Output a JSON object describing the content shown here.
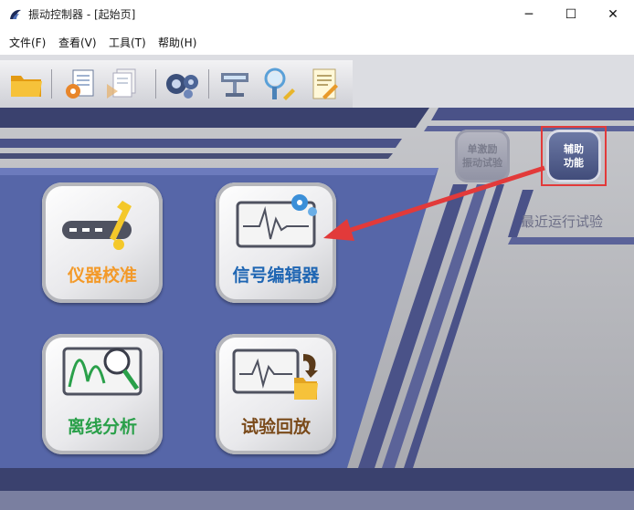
{
  "window": {
    "title": "振动控制器 - [起始页]",
    "controls": {
      "minimize": "─",
      "maximize": "☐",
      "close": "✕"
    }
  },
  "menu": {
    "items": [
      {
        "label": "文件(F)"
      },
      {
        "label": "查看(V)"
      },
      {
        "label": "工具(T)"
      },
      {
        "label": "帮助(H)"
      }
    ]
  },
  "toolbar": {
    "buttons": [
      {
        "icon": "open-folder-icon"
      },
      {
        "icon": "document-settings-icon"
      },
      {
        "icon": "document-run-icon"
      },
      {
        "icon": "gears-icon"
      },
      {
        "icon": "hardware-connect-icon"
      },
      {
        "icon": "search-edit-icon"
      },
      {
        "icon": "report-edit-icon"
      }
    ]
  },
  "main": {
    "buttons": {
      "calibration": {
        "label": "仪器校准",
        "color": "#f39a2a"
      },
      "signal_editor": {
        "label": "信号编辑器",
        "color": "#1f66b3"
      },
      "offline_analysis": {
        "label": "离线分析",
        "color": "#2aa04a"
      },
      "playback": {
        "label": "试验回放",
        "color": "#7a4a1a"
      }
    },
    "mode": {
      "single_label": "单激励\n振动试验",
      "assist_label": "辅助\n功能"
    },
    "recent_label": "最近运行试验"
  },
  "colors": {
    "panel_blue": "#5666a8",
    "dark_navy": "#3a416e",
    "highlight_red": "#e23a3a"
  }
}
